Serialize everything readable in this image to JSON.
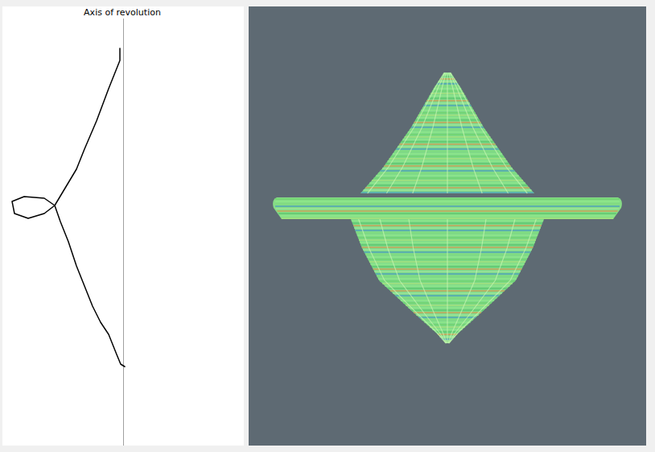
{
  "sketch": {
    "label": "Axis of revolution"
  }
}
